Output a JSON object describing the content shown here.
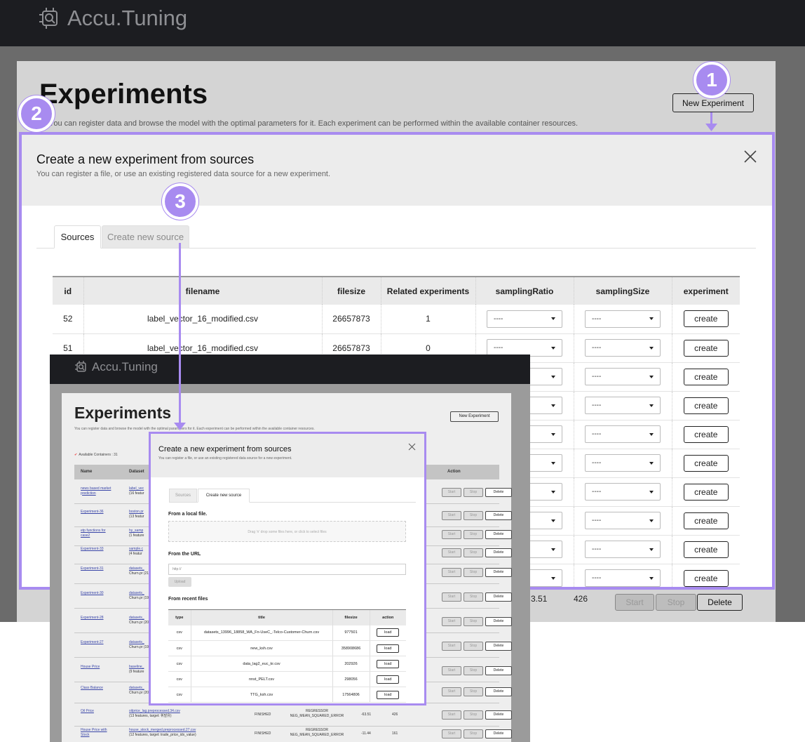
{
  "app": {
    "name": "Accu.Tuning"
  },
  "page": {
    "title": "Experiments",
    "description": "You can register data and browse the model with the optimal parameters for it. Each experiment can be performed within the available container resources.",
    "new_experiment_label": "New Experiment"
  },
  "background_row": {
    "score": "3.51",
    "time": "426",
    "start_label": "Start",
    "stop_label": "Stop",
    "delete_label": "Delete"
  },
  "modal": {
    "title": "Create a new experiment from sources",
    "subtitle": "You can register a file, or use an existing registered data source for a new experiment.",
    "close_icon": "close-icon",
    "tabs": {
      "sources": "Sources",
      "create_new_source": "Create new source"
    },
    "table": {
      "headers": {
        "id": "id",
        "filename": "filename",
        "filesize": "filesize",
        "related": "Related experiments",
        "sampling_ratio": "samplingRatio",
        "sampling_size": "samplingSize",
        "experiment": "experiment"
      },
      "select_placeholder": "----",
      "create_label": "create",
      "rows": [
        {
          "id": "52",
          "filename": "label_vector_16_modified.csv",
          "filesize": "26657873",
          "related": "1"
        },
        {
          "id": "51",
          "filename": "label_vector_16_modified.csv",
          "filesize": "26657873",
          "related": "0"
        }
      ]
    }
  },
  "inset": {
    "app_name": "Accu.Tuning",
    "title": "Experiments",
    "description": "You can register data and browse the model with the optimal parameters for it. Each experiment can be performed within the available container resources.",
    "new_experiment_label": "New Experiment",
    "available_containers": "Available Containers : 31",
    "table_headers": {
      "name": "Name",
      "dataset": "Dataset",
      "action": "Action"
    },
    "rows": [
      {
        "name": "news based market prediction",
        "dataset_link": "label_vec",
        "dataset_meta": "(16 featur"
      },
      {
        "name": "Experiment-36",
        "dataset_link": "boston.pr",
        "dataset_meta": "(13 featur"
      },
      {
        "name": "etp functions for case2",
        "dataset_link": "hy_samp",
        "dataset_meta": "(1 feature"
      },
      {
        "name": "Experiment-33",
        "dataset_link": "sample.c",
        "dataset_meta": "(4 featur"
      },
      {
        "name": "Experiment-31",
        "dataset_link": "datasets_",
        "dataset_meta": "Churn.pr (21 featur"
      },
      {
        "name": "Experiment-30",
        "dataset_link": "datasets_",
        "dataset_meta": "Churn.pr (19 featur"
      },
      {
        "name": "Experiment-28",
        "dataset_link": "datasets_",
        "dataset_meta": "Churn.pr (20 featur"
      },
      {
        "name": "Experiment-27",
        "dataset_link": "datasets_",
        "dataset_meta": "Churn.pr (19 featur"
      },
      {
        "name": "House Price",
        "dataset_link": "baseline_",
        "dataset_meta": "(9 feature"
      },
      {
        "name": "Class Balance",
        "dataset_link": "datasets_",
        "dataset_meta": "Churn.pr (20 featur"
      },
      {
        "name": "Oil Price",
        "dataset_link": "oilprice_lag.preprocessed.34.csv",
        "dataset_meta": "(13 features, target: 휘발유)",
        "status": "FINISHED",
        "metric": "REGRESSOR NEG_MEAN_SQUARED_ERROR",
        "score": "-63.51",
        "time": "426"
      },
      {
        "name": "House Price with Stock",
        "dataset_link": "house_stock_merged.preprocessed.27.csv",
        "dataset_meta": "(12 features, target: trade_price_idx_value)",
        "status": "FINISHED",
        "metric": "REGRESSOR NEG_MEAN_SQUARED_ERROR",
        "score": "-11.44",
        "time": "161"
      }
    ],
    "buttons": {
      "start": "Start",
      "stop": "Stop",
      "delete": "Delete"
    },
    "modal": {
      "title": "Create a new experiment from sources",
      "subtitle": "You can register a file, or use an existing registered data source for a new experiment.",
      "tabs": {
        "sources": "Sources",
        "create_new_source": "Create new source"
      },
      "from_local": "From a local file.",
      "drop_hint": "Drag 'n' drop some files here, or click to select files",
      "from_url": "From the URL",
      "url_placeholder": "http://",
      "upload_label": "Upload",
      "from_recent": "From recent files",
      "recent_headers": {
        "type": "type",
        "title": "title",
        "filesize": "filesize",
        "action": "action"
      },
      "load_label": "load",
      "recent_files": [
        {
          "type": "csv",
          "title": "datasets_13996_18858_WA_Fn-UseC_-Telco-Customer-Churn.csv",
          "filesize": "977501"
        },
        {
          "type": "csv",
          "title": "new_ksh.csv",
          "filesize": "358908686"
        },
        {
          "type": "csv",
          "title": "data_lag2_euc_kr.csv",
          "filesize": "202926"
        },
        {
          "type": "csv",
          "title": "nnst_PELT.csv",
          "filesize": "298056"
        },
        {
          "type": "csv",
          "title": "TTG_ksh.csv",
          "filesize": "17564806"
        }
      ]
    }
  },
  "annotations": {
    "badge1": "1",
    "badge2": "2",
    "badge3": "3"
  },
  "colors": {
    "accent": "#a88bf0",
    "topbar": "#1c1d21"
  }
}
